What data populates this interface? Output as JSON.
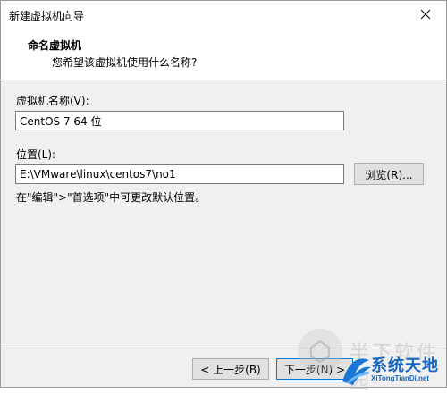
{
  "window": {
    "title": "新建虚拟机向导",
    "close_icon": "close-icon"
  },
  "header": {
    "title": "命名虚拟机",
    "subtitle": "您希望该虚拟机使用什么名称?"
  },
  "vm_name": {
    "label": "虚拟机名称(V):",
    "value": "CentOS 7 64 位"
  },
  "location": {
    "label": "位置(L):",
    "value": "E:\\VMware\\linux\\centos7\\no1",
    "browse_label": "浏览(R)..."
  },
  "hint": "在\"编辑\">\"首选项\"中可更改默认位置。",
  "footer": {
    "back_label": "< 上一步(B)",
    "next_label": "下一步(N) >"
  },
  "watermark": {
    "ghost_text": "半下软件园",
    "logo_text": "系统天地",
    "logo_url": "XiTongTianDi.net"
  },
  "colors": {
    "accent": "#0078d7",
    "logo_blue": "#1565c0"
  }
}
